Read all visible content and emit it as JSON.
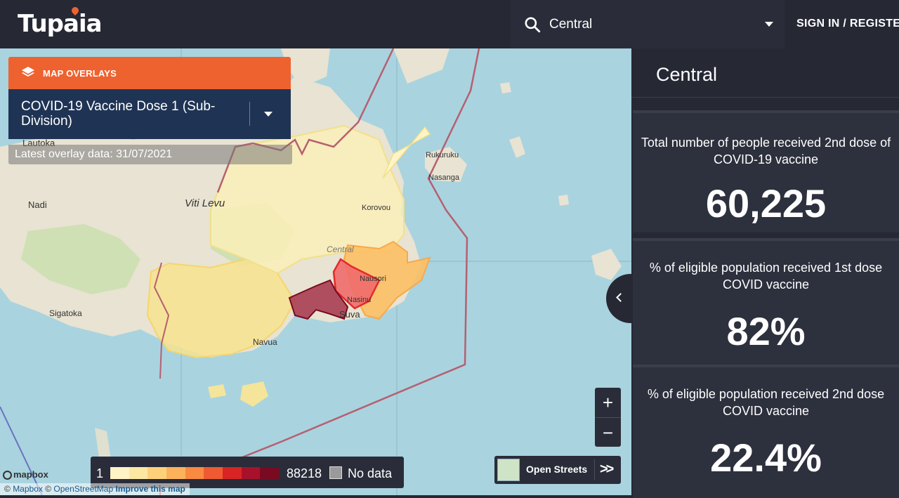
{
  "header": {
    "logo_text": "Tupaia",
    "search_value": "Central",
    "signin_label": "SIGN IN / REGISTER"
  },
  "overlay": {
    "header_label": "MAP OVERLAYS",
    "selected": "COVID-19 Vaccine Dose 1 (Sub-Division)",
    "date_text": "Latest overlay data: 31/07/2021"
  },
  "map_labels": {
    "lautoka": "Lautoka",
    "nadi": "Nadi",
    "viti_levu": "Viti Levu",
    "sigatoka": "Sigatoka",
    "navua": "Navua",
    "central": "Central",
    "korovou": "Korovou",
    "nausori": "Nausori",
    "nasinu": "Nasinu",
    "suva": "Suva",
    "rukuruku": "Rukuruku",
    "nasanga": "Nasanga"
  },
  "legend": {
    "min_label": "1",
    "max_label": "88218",
    "no_data_label": "No data",
    "colors": [
      "#fff4c6",
      "#fde8a3",
      "#fdd17a",
      "#fcb25a",
      "#f98a40",
      "#ef5a32",
      "#d92424",
      "#a8112a",
      "#7a0a22"
    ]
  },
  "basemap": {
    "label": "Open Streets",
    "expand_icon": "double-chevron-right"
  },
  "zoom": {
    "in": "+",
    "out": "−"
  },
  "attribution": {
    "logo": "mapbox",
    "prefix": "©",
    "mapbox": "Mapbox",
    "osm": "OpenStreetMap",
    "improve": "Improve this map"
  },
  "side_panel": {
    "title": "Central",
    "cards": [
      {
        "title": "Total number of people received 2nd dose of COVID-19 vaccine",
        "value": "60,225"
      },
      {
        "title": "% of eligible population received 1st dose COVID vaccine",
        "value": "82%"
      },
      {
        "title": "% of eligible population received 2nd dose COVID vaccine",
        "value": "22.4%"
      }
    ]
  },
  "colors": {
    "accent": "#ee6230",
    "overlay_select_bg": "#1f3454",
    "header_bg": "#262834",
    "water": "#a9d3df"
  }
}
